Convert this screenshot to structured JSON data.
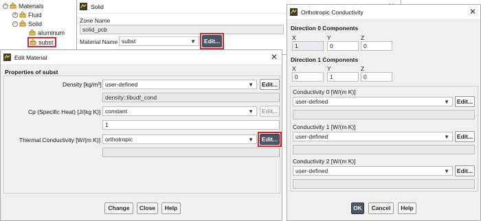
{
  "tree": {
    "materials": "Materials",
    "fluid": "Fluid",
    "solid": "Solid",
    "aluminum": "aluminum",
    "subst": "subst",
    "expanded_symbol": "−",
    "collapsed_symbol": "+"
  },
  "solid_dialog": {
    "title": "Solid",
    "zone_name_label": "Zone Name",
    "zone_name_value": "solid_pcb",
    "material_name_label": "Material Name",
    "material_name_value": "subst",
    "edit_label": "Edit..."
  },
  "edit_material": {
    "title": "Edit Material",
    "section_title": "Properties of subst",
    "density_label": "Density [kg/m³]",
    "density_method": "user-defined",
    "density_value": "density::libudf_cond",
    "cp_label": "Cp (Specific Heat) [J/(kg K)]",
    "cp_method": "constant",
    "cp_value": "1",
    "k_label": "Thermal Conductivity [W/(m K)]",
    "k_method": "orthotropic",
    "k_value": "",
    "edit_label": "Edit...",
    "change_label": "Change",
    "close_label": "Close",
    "help_label": "Help"
  },
  "ortho": {
    "title": "Orthotropic Conductivity",
    "dir0_title": "Direction 0 Components",
    "dir1_title": "Direction 1 Components",
    "x_label": "X",
    "y_label": "Y",
    "z_label": "Z",
    "dir0": {
      "x": "1",
      "y": "0",
      "z": "0"
    },
    "dir1": {
      "x": "0",
      "y": "1",
      "z": "0"
    },
    "cond0_label": "Conductivity 0 [W/(m K)]",
    "cond0_method": "user-defined",
    "cond1_label": "Conductivity 1 [W/(m K)]",
    "cond1_method": "user-defined",
    "cond2_label": "Conductivity 2 [W/(m K)]",
    "cond2_method": "user-defined",
    "edit_label": "Edit...",
    "ok_label": "OK",
    "cancel_label": "Cancel",
    "help_label": "Help"
  },
  "icons": {
    "close": "close-icon",
    "caret": "chevron-down-icon",
    "material": "material-icon",
    "app": "fluent-app-icon"
  },
  "colors": {
    "highlight": "#d4232a",
    "dark_button": "#4d5566"
  }
}
